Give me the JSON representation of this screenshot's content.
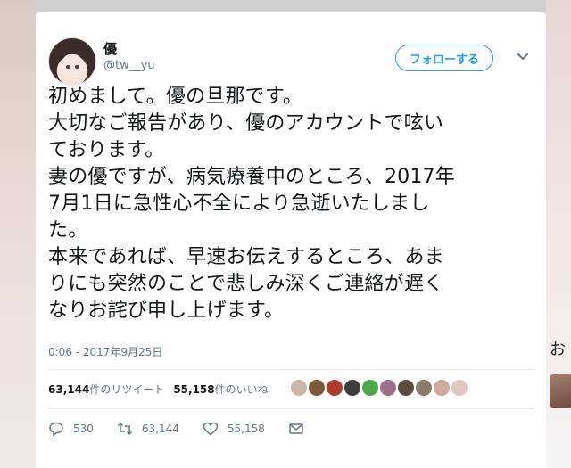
{
  "author": {
    "name": "優",
    "handle": "@tw__yu"
  },
  "follow_button": {
    "label": "フォローする"
  },
  "tweet": {
    "lines": [
      "初めまして。優の旦那です。",
      "大切なご報告があり、優のアカウントで呟い",
      "ております。",
      "妻の優ですが、病気療養中のところ、2017年",
      "7月1日に急性心不全により急逝いたしまし",
      "た。",
      "本来であれば、早速お伝えするところ、あま",
      "りにも突然のことで悲しみ深くご連絡が遅く",
      "なりお詫び申し上げます。"
    ],
    "timestamp": "0:06 - 2017年9月25日"
  },
  "stats": {
    "retweet_count": "63,144",
    "retweet_label": "件のリツイート",
    "like_count": "55,158",
    "like_label": "件のいいね"
  },
  "likers": [
    {
      "icon": "liker-avatar",
      "color": "#c9b6a8"
    },
    {
      "icon": "liker-avatar",
      "color": "#7a5a3a"
    },
    {
      "icon": "liker-avatar",
      "color": "#b23a2f"
    },
    {
      "icon": "liker-avatar",
      "color": "#3d3d3d"
    },
    {
      "icon": "liker-avatar",
      "color": "#4aa84a"
    },
    {
      "icon": "liker-avatar",
      "color": "#9c6f8a"
    },
    {
      "icon": "liker-avatar",
      "color": "#5c4a3e"
    },
    {
      "icon": "liker-avatar",
      "color": "#8a7a6a"
    },
    {
      "icon": "liker-avatar",
      "color": "#d4a7a0"
    },
    {
      "icon": "liker-avatar",
      "color": "#e0c8c0"
    }
  ],
  "actions": {
    "reply": {
      "icon": "reply-icon",
      "count": "530"
    },
    "retweet": {
      "icon": "retweet-icon",
      "count": "63,144"
    },
    "like": {
      "icon": "heart-icon",
      "count": "55,158"
    },
    "dm": {
      "icon": "mail-icon"
    }
  },
  "background": {
    "right_fragment": "お"
  },
  "colors": {
    "accent": "#1da1f2",
    "text": "#14171a",
    "muted": "#657786"
  }
}
